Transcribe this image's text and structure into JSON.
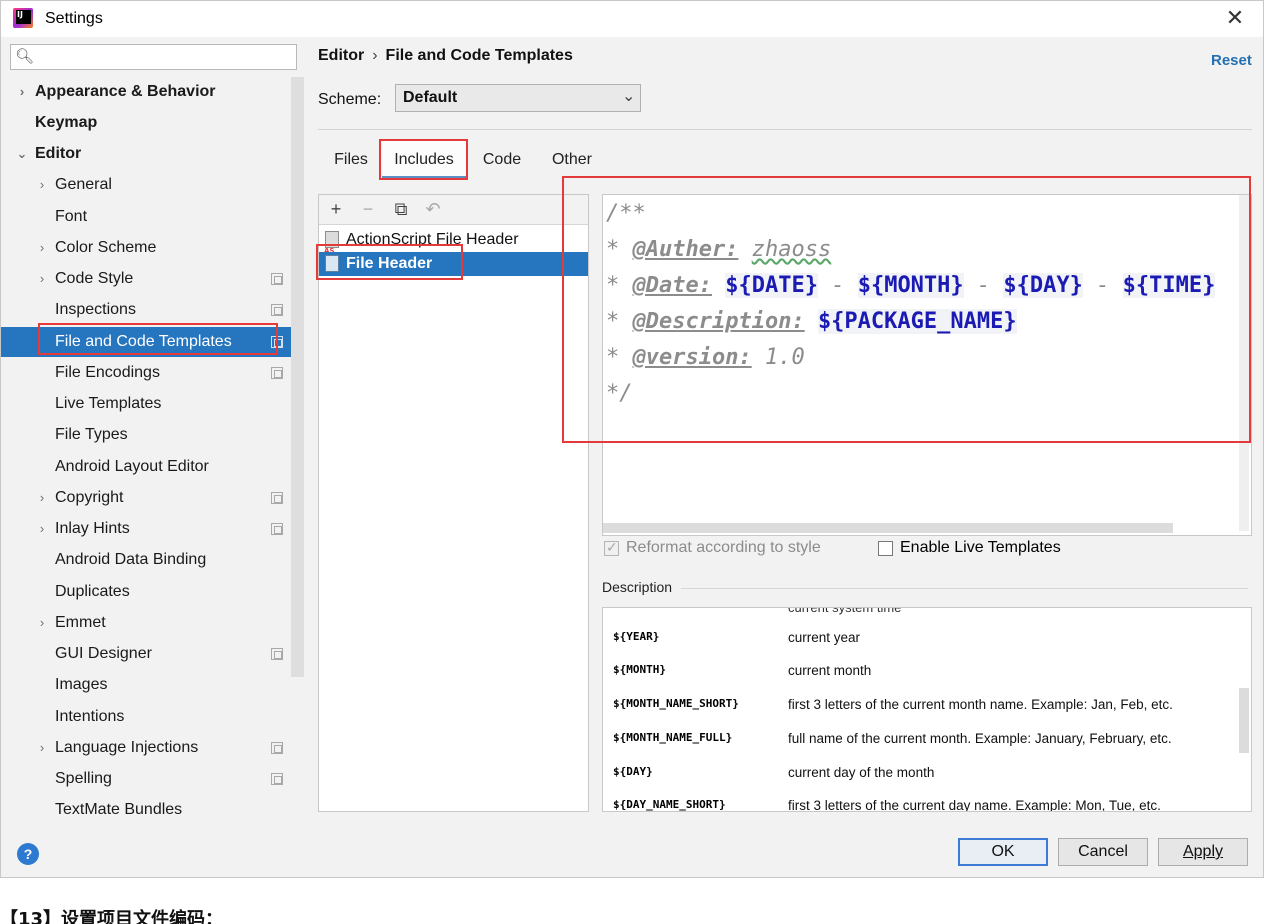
{
  "window": {
    "title": "Settings"
  },
  "search": {
    "placeholder": ""
  },
  "tree": [
    {
      "label": "Appearance & Behavior",
      "arrow": "›"
    },
    {
      "label": "Keymap",
      "arrow": ""
    },
    {
      "label": "Editor",
      "arrow": "⌄"
    },
    {
      "label": "General",
      "arrow": "›"
    },
    {
      "label": "Font",
      "arrow": ""
    },
    {
      "label": "Color Scheme",
      "arrow": "›"
    },
    {
      "label": "Code Style",
      "arrow": "›"
    },
    {
      "label": "Inspections",
      "arrow": ""
    },
    {
      "label": "File and Code Templates",
      "arrow": ""
    },
    {
      "label": "File Encodings",
      "arrow": ""
    },
    {
      "label": "Live Templates",
      "arrow": ""
    },
    {
      "label": "File Types",
      "arrow": ""
    },
    {
      "label": "Android Layout Editor",
      "arrow": ""
    },
    {
      "label": "Copyright",
      "arrow": "›"
    },
    {
      "label": "Inlay Hints",
      "arrow": "›"
    },
    {
      "label": "Android Data Binding",
      "arrow": ""
    },
    {
      "label": "Duplicates",
      "arrow": ""
    },
    {
      "label": "Emmet",
      "arrow": "›"
    },
    {
      "label": "GUI Designer",
      "arrow": ""
    },
    {
      "label": "Images",
      "arrow": ""
    },
    {
      "label": "Intentions",
      "arrow": ""
    },
    {
      "label": "Language Injections",
      "arrow": "›"
    },
    {
      "label": "Spelling",
      "arrow": ""
    },
    {
      "label": "TextMate Bundles",
      "arrow": ""
    }
  ],
  "breadcrumb": {
    "parent": "Editor",
    "separator": "›",
    "current": "File and Code Templates"
  },
  "reset_label": "Reset",
  "scheme": {
    "label": "Scheme:",
    "value": "Default"
  },
  "tabs": [
    "Files",
    "Includes",
    "Code",
    "Other"
  ],
  "templates": [
    "ActionScript File Header",
    "File Header"
  ],
  "toolbar": {
    "add": "+",
    "remove": "−",
    "copy": "⧉",
    "reset": "↶"
  },
  "editor": {
    "line1": "/**",
    "line2_star": "* ",
    "line2_tag": "@Auther:",
    "line2_value": "zhaoss",
    "line3_star": "* ",
    "line3_tag": "@Date:",
    "var_date": "${DATE}",
    "var_month": "${MONTH}",
    "var_day": "${DAY}",
    "var_time": "${TIME}",
    "dash": " - ",
    "line4_star": "* ",
    "line4_tag": "@Description:",
    "var_package": "${PACKAGE_NAME}",
    "line5_star": "* ",
    "line5_tag": "@version:",
    "line5_value": "1.0",
    "line6": "*/"
  },
  "options": {
    "reformat": "Reformat according to style",
    "live_templates": "Enable Live Templates"
  },
  "description": {
    "label": "Description",
    "cut_text": "current system time",
    "rows": [
      {
        "var": "${YEAR}",
        "text": "current year"
      },
      {
        "var": "${MONTH}",
        "text": "current month"
      },
      {
        "var": "${MONTH_NAME_SHORT}",
        "text": "first 3 letters of the current month name. Example: Jan, Feb, etc."
      },
      {
        "var": "${MONTH_NAME_FULL}",
        "text": "full name of the current month. Example: January, February, etc."
      },
      {
        "var": "${DAY}",
        "text": "current day of the month"
      },
      {
        "var": "${DAY_NAME_SHORT}",
        "text": "first 3 letters of the current day name. Example: Mon, Tue, etc."
      }
    ]
  },
  "buttons": {
    "help": "?",
    "ok": "OK",
    "cancel": "Cancel",
    "apply": "Apply"
  },
  "caption": "【13】设置项目文件编码："
}
